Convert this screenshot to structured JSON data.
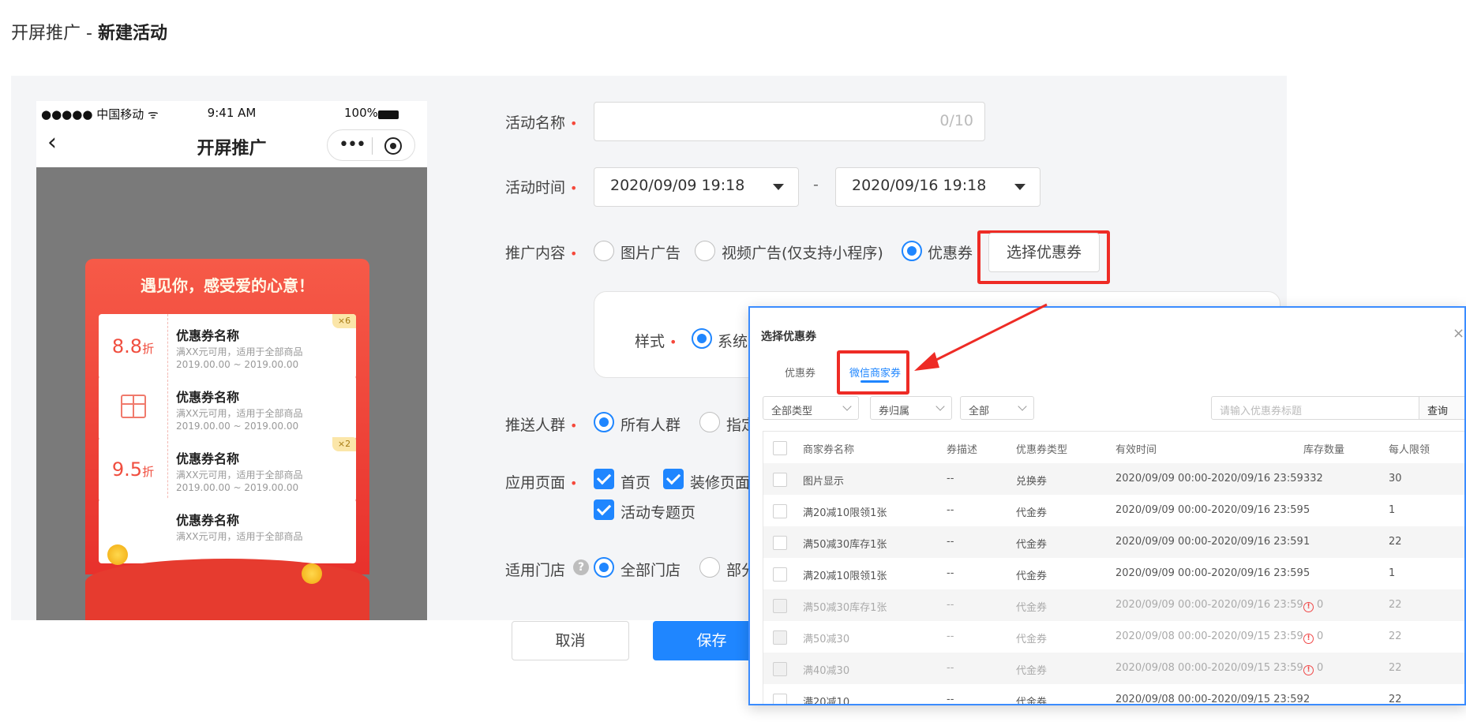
{
  "header": {
    "title": "开屏推广",
    "separator": " - ",
    "subtitle": "新建活动"
  },
  "phone": {
    "status": {
      "carrier": "●●●●● 中国移动 ᯤ",
      "time": "9:41 AM",
      "battery": "100%"
    },
    "nav": {
      "back": "‹",
      "title": "开屏推广",
      "capsule_dots": "•••"
    },
    "card": {
      "banner": "遇见你，感受爱的心意！",
      "coupons": [
        {
          "value": "8.8",
          "unit": "折",
          "title": "优惠券名称",
          "line1": "满XX元可用，适用于全部商品",
          "line2": "2019.00.00 ~ 2019.00.00",
          "badge": "×6"
        },
        {
          "value": "",
          "unit": "",
          "title": "优惠券名称",
          "line1": "满XX元可用，适用于全部商品",
          "line2": "2019.00.00 ~ 2019.00.00",
          "badge": ""
        },
        {
          "value": "9.5",
          "unit": "折",
          "title": "优惠券名称",
          "line1": "满XX元可用，适用于全部商品",
          "line2": "2019.00.00 ~ 2019.00.00",
          "badge": "×2"
        },
        {
          "value": "",
          "unit": "",
          "title": "优惠券名称",
          "line1": "满XX元可用，适用于全部商品",
          "line2": "",
          "badge": ""
        }
      ]
    }
  },
  "form": {
    "activity_name": {
      "label": "活动名称",
      "counter": "0/10"
    },
    "activity_time": {
      "label": "活动时间",
      "start": "2020/09/09 19:18",
      "end": "2020/09/16 19:18",
      "dash": "-"
    },
    "promo_content": {
      "label": "推广内容",
      "options": [
        "图片广告",
        "视频广告(仅支持小程序)",
        "优惠券"
      ],
      "select_button": "选择优惠券"
    },
    "style": {
      "label": "样式",
      "option": "系统"
    },
    "audience": {
      "label": "推送人群",
      "options": [
        "所有人群",
        "指定"
      ]
    },
    "pages": {
      "label": "应用页面",
      "options": [
        "首页",
        "装修页面",
        "活动专题页"
      ]
    },
    "stores": {
      "label": "适用门店",
      "help": "?",
      "options": [
        "全部门店",
        "部分"
      ]
    }
  },
  "footer": {
    "cancel": "取消",
    "save": "保存"
  },
  "dialog": {
    "title": "选择优惠券",
    "close": "×",
    "tabs": [
      "优惠券",
      "微信商家券"
    ],
    "filters": [
      "全部类型",
      "券归属",
      "全部"
    ],
    "search_placeholder": "请输入优惠券标题",
    "query": "查询",
    "columns": [
      "商家券名称",
      "券描述",
      "优惠券类型",
      "有效时间",
      "库存数量",
      "每人限领"
    ],
    "rows": [
      [
        "图片显示",
        "--",
        "兑换券",
        "2020/09/09 00:00-2020/09/16 23:59",
        "332",
        "30"
      ],
      [
        "满20减10限领1张",
        "--",
        "代金券",
        "2020/09/09 00:00-2020/09/16 23:59",
        "5",
        "1"
      ],
      [
        "满50减30库存1张",
        "--",
        "代金券",
        "2020/09/09 00:00-2020/09/16 23:59",
        "1",
        "22"
      ],
      [
        "满20减10限领1张",
        "--",
        "代金券",
        "2020/09/09 00:00-2020/09/16 23:59",
        "5",
        "1"
      ],
      [
        "满50减30库存1张",
        "--",
        "代金券",
        "2020/09/09 00:00-2020/09/16 23:59",
        "0",
        "22"
      ],
      [
        "满50减30",
        "--",
        "代金券",
        "2020/09/08 00:00-2020/09/15 23:59",
        "0",
        "22"
      ],
      [
        "满40减30",
        "--",
        "代金券",
        "2020/09/08 00:00-2020/09/15 23:59",
        "0",
        "22"
      ],
      [
        "满20减10",
        "--",
        "代金券",
        "2020/09/08 00:00-2020/09/15 23:59",
        "2",
        "22"
      ]
    ]
  },
  "colors": {
    "primary": "#1f86ff",
    "highlight": "#ee2b25",
    "required": "#f5483b"
  }
}
